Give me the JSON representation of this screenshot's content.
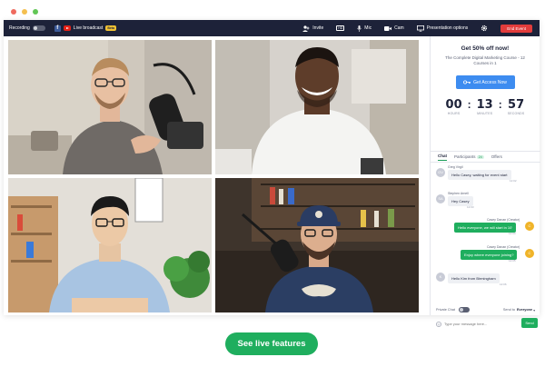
{
  "window": {
    "dot_colors": [
      "#ef6a5e",
      "#f4bf4f",
      "#62c655"
    ]
  },
  "topbar": {
    "recording_label": "Recording",
    "recording_toggle": "OFF",
    "live_broadcast_label": "Live broadcast",
    "beta_badge": "Beta",
    "invite_label": "Invite",
    "hd_label": "HD",
    "mic_label": "Mic",
    "cam_label": "Cam",
    "presentation_label": "Presentation options",
    "end_event_label": "End Event",
    "colors": {
      "bar": "#1d2239",
      "end_button": "#e23c3c"
    }
  },
  "videos": [
    {
      "name": "participant-1"
    },
    {
      "name": "participant-2"
    },
    {
      "name": "participant-3"
    },
    {
      "name": "participant-4"
    }
  ],
  "promo": {
    "title": "Get 50% off now!",
    "subtitle": "The Complete Digital Marketing Course - 12 Courses in 1",
    "button_label": "Get Access Now",
    "timer": {
      "hours": "00",
      "minutes": "13",
      "seconds": "57"
    },
    "timer_labels": {
      "hours": "HOURS",
      "minutes": "MINUTES",
      "seconds": "SECONDS"
    }
  },
  "tabs": {
    "chat": "Chat",
    "participants": "Participants",
    "participants_count": "24",
    "offers": "Offers"
  },
  "chat": {
    "messages": [
      {
        "sender": "Greg Virgil",
        "text": "Hello Casey, waiting for event start",
        "time": "12:02",
        "outgoing": false
      },
      {
        "sender": "Stephen Arnell",
        "text": "Hey Casey",
        "time": "12:03",
        "outgoing": false
      },
      {
        "sender": "Casey Danan (Creator)",
        "text": "Hello everyone, we will start in 10'",
        "time": "12:04",
        "outgoing": true
      },
      {
        "sender": "Casey Danan (Creator)",
        "text": "Enjoy where everyone joining?",
        "time": "12:05",
        "outgoing": true
      },
      {
        "sender": "",
        "text": "Hello Kim from Birmingham",
        "time": "12:06",
        "outgoing": false
      }
    ]
  },
  "chat_footer": {
    "private_chat_label": "Private Chat",
    "private_toggle": "OFF",
    "send_to_label": "Send to",
    "send_to_value": "Everyone",
    "input_placeholder": "Type your message here...",
    "send_label": "Send"
  },
  "cta": {
    "label": "See live features",
    "color": "#1fae5e"
  }
}
